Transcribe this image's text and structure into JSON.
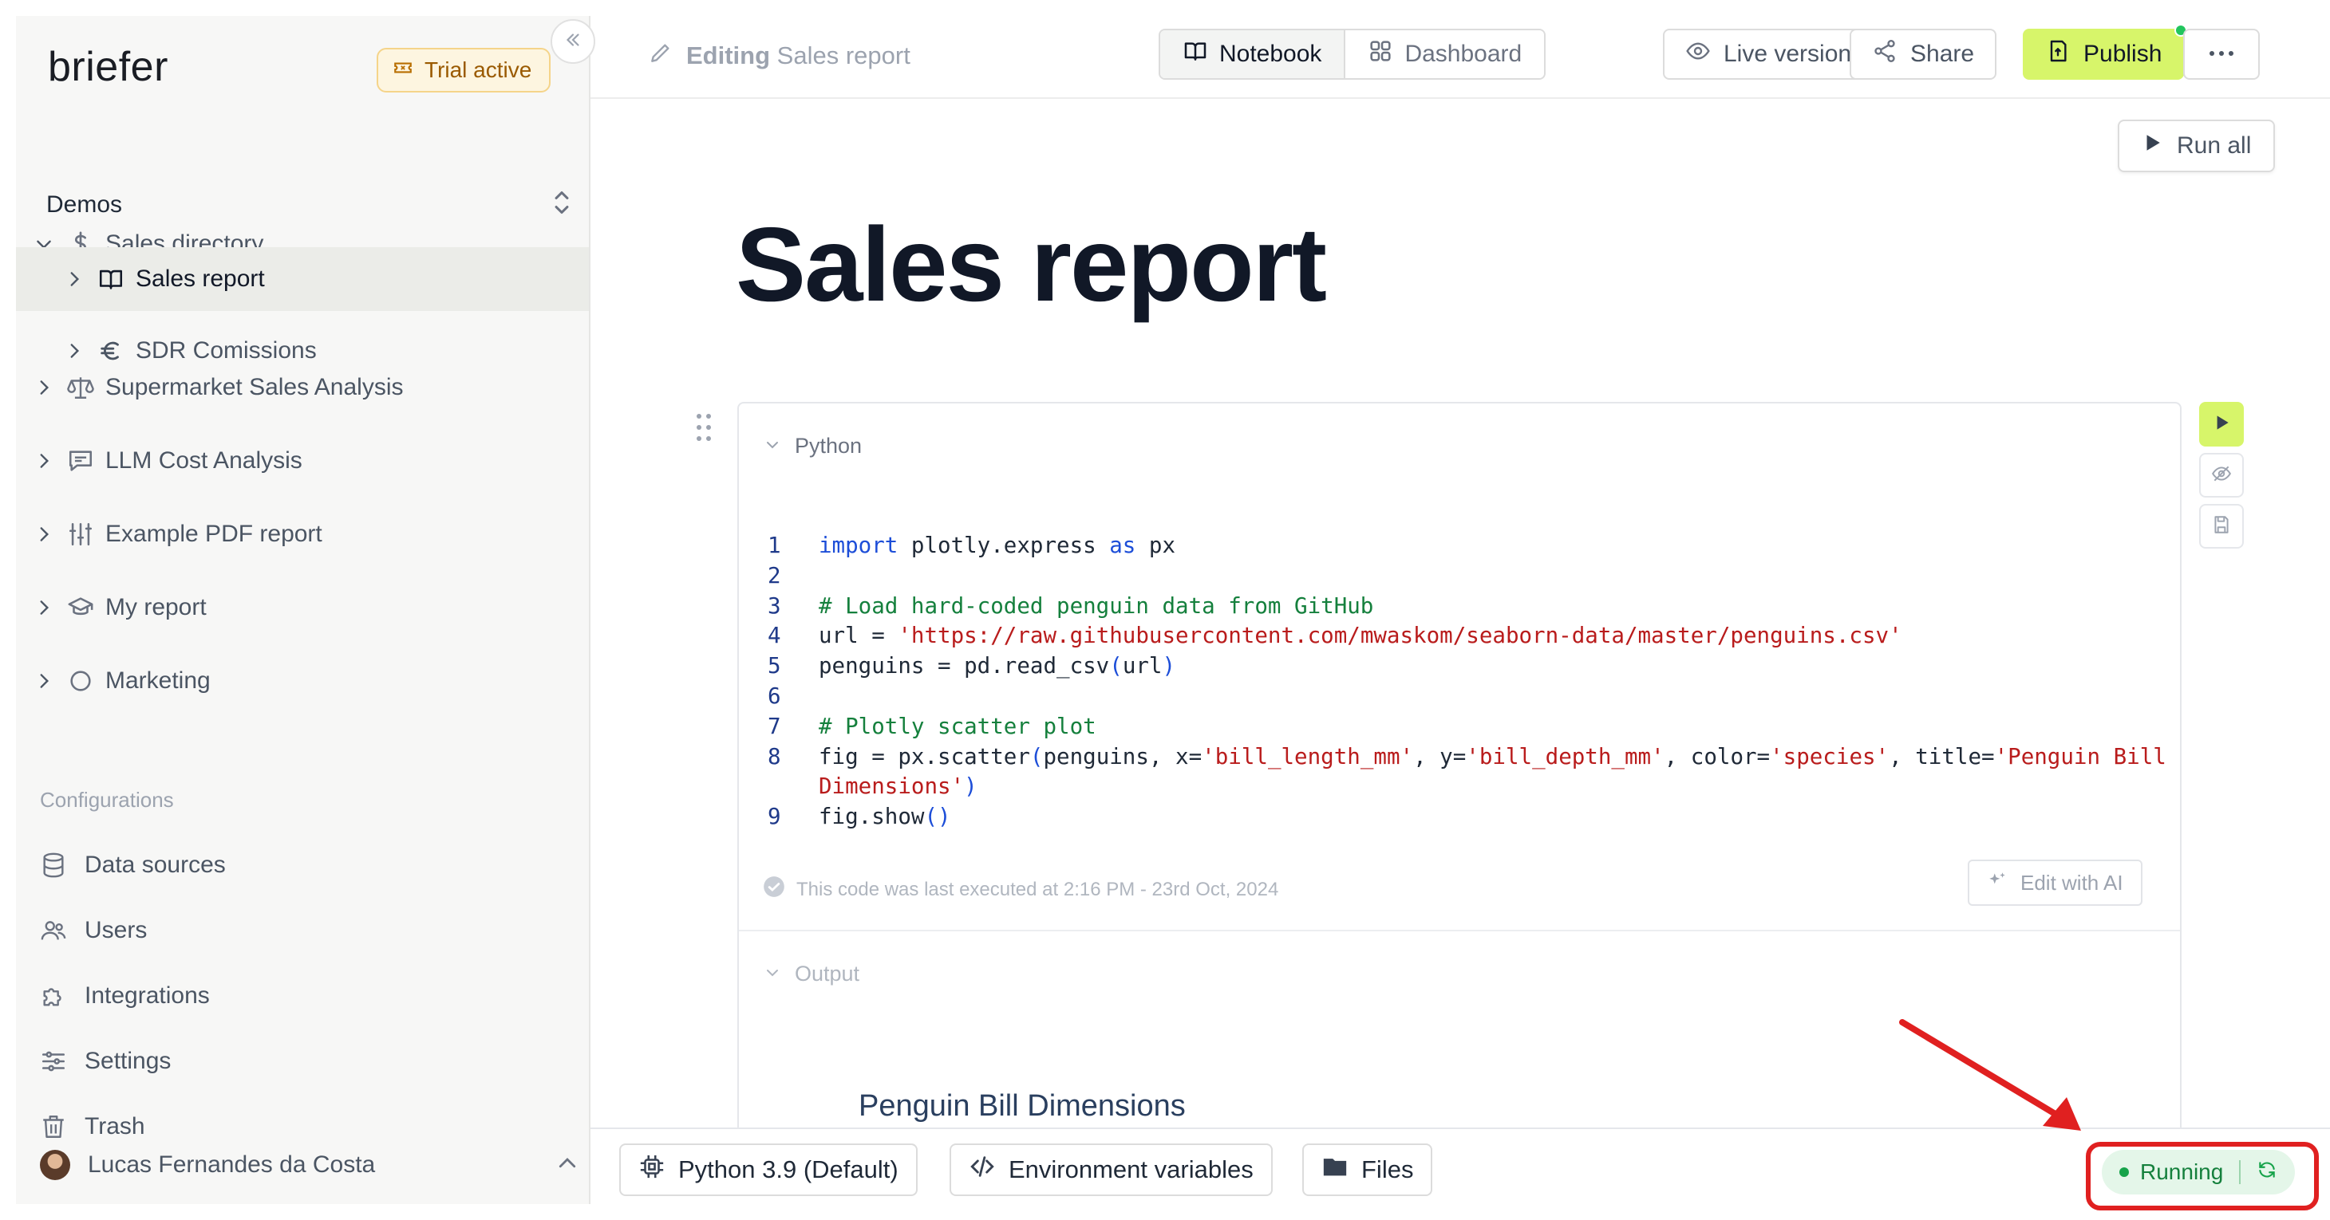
{
  "sidebar": {
    "logo": "briefer",
    "trial_badge": "Trial active",
    "workspace": "Demos",
    "tree": [
      {
        "label": "Sales directory",
        "icon": "dollar-icon",
        "expanded": true,
        "level": 0
      },
      {
        "label": "Sales report",
        "icon": "book-icon",
        "expanded": false,
        "level": 1,
        "active": true
      },
      {
        "label": "SDR Comissions",
        "icon": "euro-icon",
        "expanded": false,
        "level": 1
      },
      {
        "label": "Supermarket Sales Analysis",
        "icon": "scale-icon",
        "expanded": false,
        "level": 0
      },
      {
        "label": "LLM Cost Analysis",
        "icon": "chat-icon",
        "expanded": false,
        "level": 0
      },
      {
        "label": "Example PDF report",
        "icon": "sliders-icon",
        "expanded": false,
        "level": 0
      },
      {
        "label": "My report",
        "icon": "graduation-cap-icon",
        "expanded": false,
        "level": 0
      },
      {
        "label": "Marketing",
        "icon": "circle-icon",
        "expanded": false,
        "level": 0
      }
    ],
    "configurations_title": "Configurations",
    "config_items": [
      {
        "label": "Data sources",
        "icon": "database-icon"
      },
      {
        "label": "Users",
        "icon": "users-icon"
      },
      {
        "label": "Integrations",
        "icon": "puzzle-icon"
      },
      {
        "label": "Settings",
        "icon": "settings-sliders-icon"
      },
      {
        "label": "Trash",
        "icon": "trash-icon"
      }
    ],
    "user_name": "Lucas Fernandes da Costa"
  },
  "topbar": {
    "editing_label": "Editing",
    "document_name": "Sales report",
    "view_tabs": [
      {
        "label": "Notebook",
        "selected": true
      },
      {
        "label": "Dashboard",
        "selected": false
      }
    ],
    "live_version": "Live version",
    "share": "Share",
    "publish": "Publish"
  },
  "main": {
    "run_all": "Run all",
    "page_title": "Sales report",
    "block": {
      "type_label": "Python",
      "code_lines": [
        {
          "n": "1",
          "parts": [
            [
              "kw",
              "import"
            ],
            [
              "tx",
              " plotly.express "
            ],
            [
              "kw",
              "as"
            ],
            [
              "tx",
              " px"
            ]
          ]
        },
        {
          "n": "2",
          "parts": []
        },
        {
          "n": "3",
          "parts": [
            [
              "cm",
              "# Load hard-coded penguin data from GitHub"
            ]
          ]
        },
        {
          "n": "4",
          "parts": [
            [
              "tx",
              "url = "
            ],
            [
              "st",
              "'https://raw.githubusercontent.com/mwaskom/seaborn-data/master/penguins.csv'"
            ]
          ]
        },
        {
          "n": "5",
          "parts": [
            [
              "tx",
              "penguins = pd.read_csv"
            ],
            [
              "pn",
              "("
            ],
            [
              "tx",
              "url"
            ],
            [
              "pn",
              ")"
            ]
          ]
        },
        {
          "n": "6",
          "parts": []
        },
        {
          "n": "7",
          "parts": [
            [
              "cm",
              "# Plotly scatter plot"
            ]
          ]
        },
        {
          "n": "8",
          "parts": [
            [
              "tx",
              "fig = px.scatter"
            ],
            [
              "pn",
              "("
            ],
            [
              "tx",
              "penguins, x="
            ],
            [
              "st",
              "'bill_length_mm'"
            ],
            [
              "tx",
              ", y="
            ],
            [
              "st",
              "'bill_depth_mm'"
            ],
            [
              "tx",
              ", color="
            ],
            [
              "st",
              "'species'"
            ],
            [
              "tx",
              ", title="
            ],
            [
              "st",
              "'Penguin Bill"
            ]
          ]
        },
        {
          "n": "",
          "parts": [
            [
              "st",
              "Dimensions'"
            ],
            [
              "pn",
              ")"
            ]
          ]
        },
        {
          "n": "9",
          "parts": [
            [
              "tx",
              "fig.show"
            ],
            [
              "pn",
              "()"
            ]
          ]
        }
      ],
      "last_executed": "This code was last executed at 2:16 PM - 23rd Oct, 2024",
      "edit_with_ai": "Edit with AI",
      "output_label": "Output",
      "plot_title": "Penguin Bill Dimensions"
    }
  },
  "bottombar": {
    "python_env": "Python 3.9 (Default)",
    "env_vars": "Environment variables",
    "files": "Files",
    "status": "Running"
  },
  "colors": {
    "accent": "#d7f56a",
    "running_bg": "#e4f6e9",
    "running_text": "#15803d",
    "annotation": "#e02020"
  }
}
